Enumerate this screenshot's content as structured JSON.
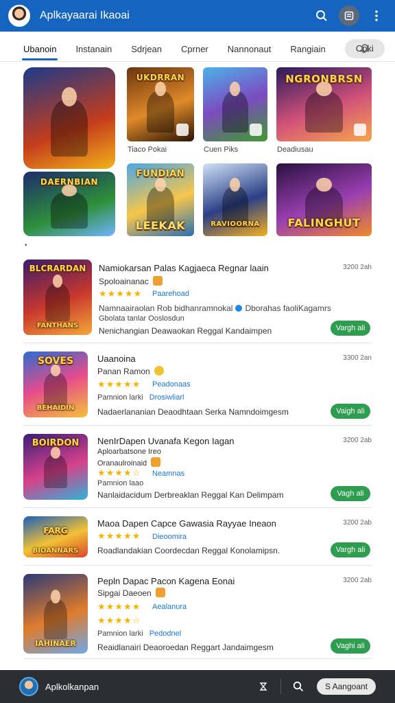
{
  "app": {
    "title": "Aplkayaarai Ikaoai"
  },
  "tabs": [
    {
      "label": "Ubanoin"
    },
    {
      "label": "Instanain"
    },
    {
      "label": "Sdrjean"
    },
    {
      "label": "Cprner"
    },
    {
      "label": "Nannonaut"
    },
    {
      "label": "Rangiain"
    },
    {
      "label": "Cpki"
    }
  ],
  "featured": {
    "tiles": [
      {
        "title": "",
        "colors": [
          "#1d3a8a",
          "#c43d1b",
          "#f3b21c"
        ]
      },
      {
        "title": "UKDRRAN",
        "colors": [
          "#6b3410",
          "#e08a2a",
          "#2a1405"
        ]
      },
      {
        "title": "",
        "colors": [
          "#4db2e8",
          "#7c4bc1",
          "#3f9b2f"
        ]
      },
      {
        "title": "NGRONBRSN",
        "colors": [
          "#2b1a5e",
          "#d2527a",
          "#f6a64b"
        ]
      },
      {
        "title": "DAERNBIAN",
        "colors": [
          "#1e2c6b",
          "#2e8f3a",
          "#6fb4ff"
        ]
      },
      {
        "title": "FUNDIAN",
        "colors": [
          "#4aa8e6",
          "#f7c64a",
          "#2b6fb3"
        ]
      },
      {
        "title": "RAVIOORNA",
        "colors": [
          "#cfe3f7",
          "#2c3f86",
          "#f3b11f"
        ]
      },
      {
        "title": "FALINGHUT",
        "colors": [
          "#2a1040",
          "#9a3fb0",
          "#f08a2b"
        ]
      }
    ],
    "tile_bottom_titles": [
      "",
      "",
      "",
      "",
      "",
      "LEEKAK",
      "",
      ""
    ],
    "captions": [
      "Tiaco Pokai",
      "Cuen Piks",
      "Deadiusau"
    ],
    "marker": "•"
  },
  "list": [
    {
      "name": "Namiokarsan  Palas  Kagjaeca  Regnar  laain",
      "size": "3200 2ah",
      "sub": "Spoloainanac",
      "sub_icon": "reward-icon",
      "rating_label": "Paarehoad",
      "stars": "★★★★★",
      "extra1": "Namnaairaolan  Rob bidhanramnokal",
      "extra1b": "Dborahas  faoliKagamrs",
      "extra2": "Gbolata  tanlar  Ooslosdun",
      "desc": "Nenichangian  Deawaokan  Reggal  Kandaimpen",
      "get": "Vargh ali",
      "thumb_title": "BLCRARDAN",
      "thumb_title2": "FANTHANS",
      "colors": [
        "#3b1c6b",
        "#c9372c",
        "#f2a93a"
      ]
    },
    {
      "name": "Uaanoina",
      "size": "3300 2an",
      "sub": "Panan Ramon",
      "sub_icon": "reward-icon",
      "rating_label": "Peadonaas",
      "stars": "★★★★★",
      "extra2": "Pamnion  larki",
      "extra2_blue": "Drosiwliarl",
      "desc": "Nadaerlananian  Deaodhtaan  Serka  Namndoimgesm",
      "get": "Vaigh ali",
      "thumb_title": "SOVES",
      "thumb_title2": "BEHAIDIN",
      "colors": [
        "#2b6dd1",
        "#e74c8b",
        "#f3c23a"
      ]
    },
    {
      "name": "NenIrDapen  Uvanafa  Kegon  Iagan",
      "size": "3200 2ab",
      "sub": "Aploarbatsone  Ireo",
      "sub2": "Oranaulroinaid",
      "sub_icon": "reward-icon",
      "rating_label": "Neamnas",
      "stars": "★★★★☆",
      "extra2": "Pamnion  laao",
      "desc": "Nanlaidacidum  Derbreaklan  Reggal  Kan  Delimpam",
      "get": "Vagh ali",
      "thumb_title": "BOIRDON",
      "thumb_title2": "",
      "colors": [
        "#3a1f7a",
        "#d6418a",
        "#2fb3d8"
      ]
    },
    {
      "name": "Maoa  Dapen  Capce  Gawasia  Rayyae  Ineaon",
      "size": "3200 2ab",
      "rating_label": "Dieoomira",
      "stars": "★★★★★",
      "desc": "Roadlandakian  Coordecdan  Reggal  Konolamipsn.",
      "get": "Vargh ali",
      "thumb_title": "FARG",
      "thumb_title2": "BIOANNARS",
      "colors": [
        "#1b5fb8",
        "#f2c136",
        "#d9472a"
      ]
    },
    {
      "name": "Pepln  Dapac  Pacon  Kagena  Eonai",
      "size": "3200 2ab",
      "sub": "Sipgai  Daeoen",
      "sub_icon": "reward-icon",
      "rating_label": "Aealanura",
      "stars": "★★★★★",
      "stars2": "★★★★☆",
      "extra2": "Pamnion  larki",
      "extra2_blue": "Pedodnel",
      "desc": "Reaidlanairi  Deaoroedan  Reggart  Jandaimgesm",
      "get": "Vaghi ali",
      "thumb_title": "",
      "thumb_title2": "IAHINAER",
      "colors": [
        "#2a3a78",
        "#e07b2c",
        "#6fa8e8"
      ]
    }
  ],
  "bottom_bar": {
    "label": "Aplkolkanpan",
    "search_label": "S Aangoant"
  },
  "colors": {
    "appbar": "#1565c0",
    "accent_green": "#2e9d50",
    "star": "#f5b400",
    "link_blue": "#1976d2"
  }
}
